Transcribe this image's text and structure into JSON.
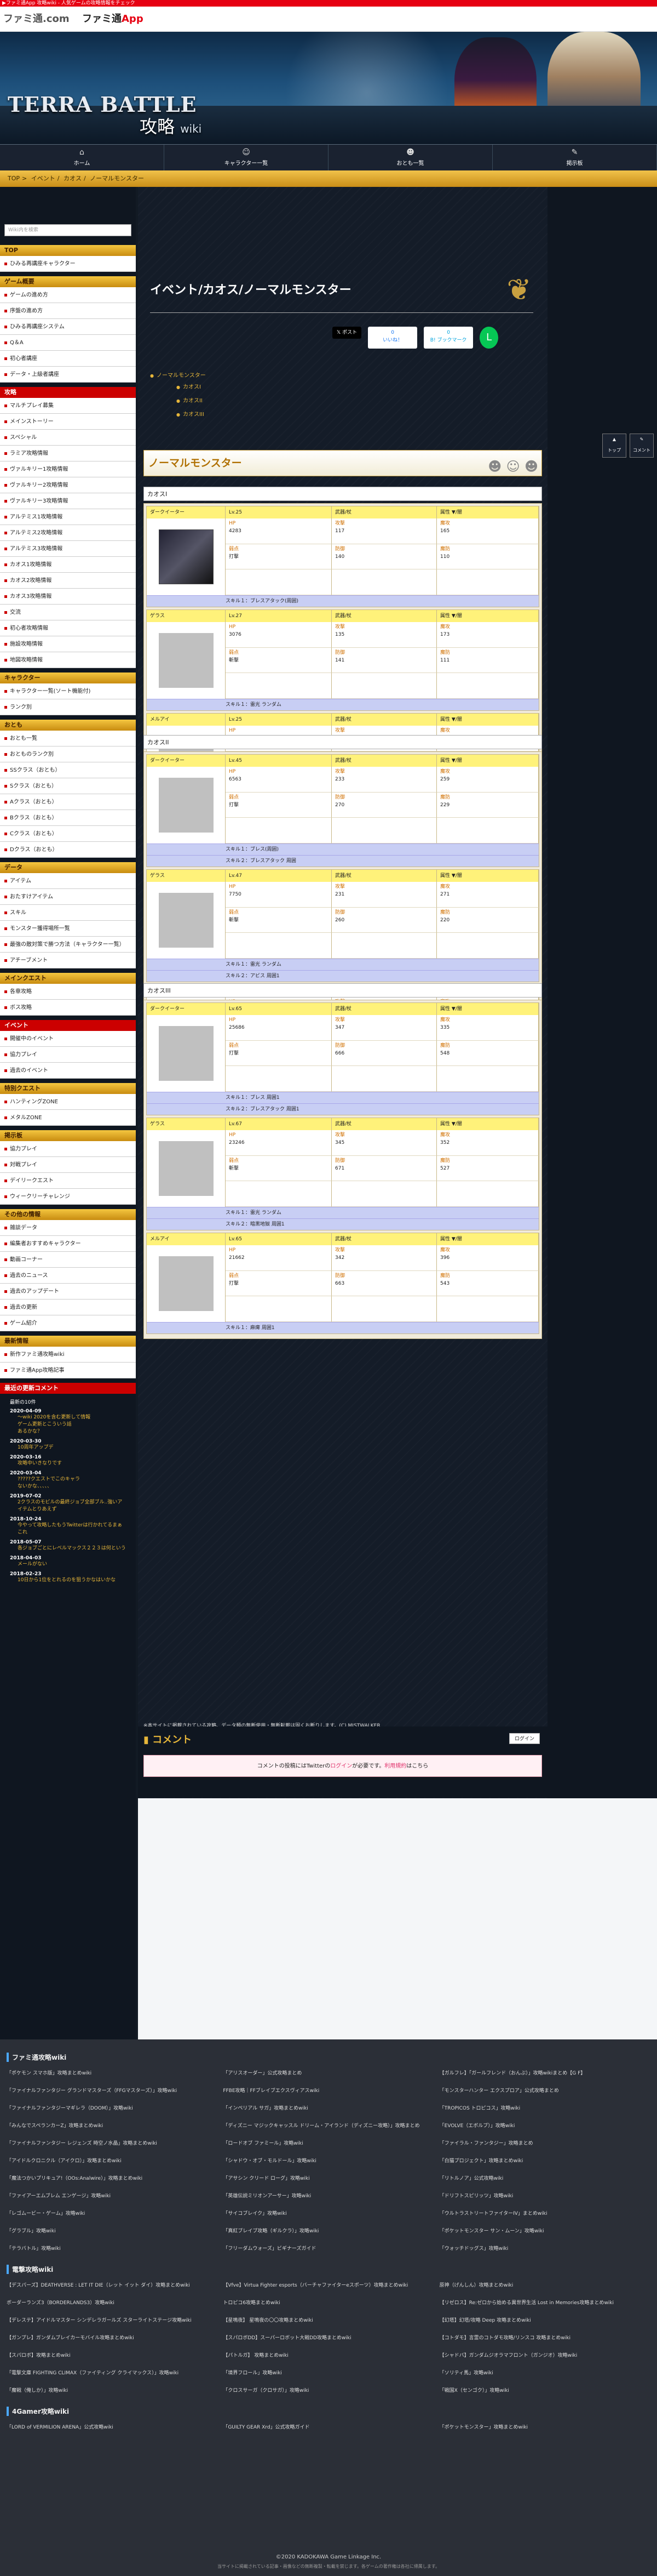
{
  "top_strip": "▶ファミ通App 攻略wiki - 人気ゲームの攻略情報をチェック",
  "site_logo": "ファミ通.com",
  "app_logo": {
    "pre": "ファミ通",
    "post": "App"
  },
  "banner": {
    "logo": "TERRA BATTLE",
    "title": "攻略",
    "title_small": "wiki"
  },
  "nav": [
    {
      "icon": "home-icon",
      "glyph": "⌂",
      "label": "ホーム"
    },
    {
      "icon": "character-icon",
      "glyph": "☺",
      "label": "キャラクター一覧"
    },
    {
      "icon": "monster-icon",
      "glyph": "☻",
      "label": "おとも一覧"
    },
    {
      "icon": "chat-icon",
      "glyph": "✎",
      "label": "掲示板"
    }
  ],
  "breadcrumb": [
    "TOP",
    "イベント",
    "カオス",
    "ノーマルモンスター"
  ],
  "search": {
    "placeholder": "Wiki内を検索"
  },
  "sidebar": [
    {
      "head": "TOP",
      "red": false,
      "items": [
        "ひみる再講座キャラクター"
      ]
    },
    {
      "head": "ゲーム概要",
      "red": false,
      "items": [
        "ゲームの進め方",
        "序盤の進め方",
        "ひみる再講座システム",
        "Q＆A",
        "初心者講座",
        "データ・上級者講座"
      ]
    },
    {
      "head": "攻略",
      "red": true,
      "items": [
        "マルチプレイ募集",
        "メインストーリー",
        "スペシャル",
        "ラミア攻略情報",
        "ヴァルキリー1攻略情報",
        "ヴァルキリー2攻略情報",
        "ヴァルキリー3攻略情報",
        "アルテミス1攻略情報",
        "アルテミス2攻略情報",
        "アルテミス3攻略情報",
        "カオス1攻略情報",
        "カオス2攻略情報",
        "カオス3攻略情報",
        "交流",
        "初心者攻略情報",
        "施設攻略情報",
        "地図攻略情報"
      ]
    },
    {
      "head": "キャラクター",
      "red": false,
      "items": [
        "キャラクター一覧(ソート機能付)",
        "ランク別"
      ]
    },
    {
      "head": "おとも",
      "red": false,
      "items": [
        "おとも一覧",
        "おとものランク別",
        "SSクラス（おとも）",
        "Sクラス（おとも）",
        "Aクラス（おとも）",
        "Bクラス（おとも）",
        "Cクラス（おとも）",
        "Dクラス（おとも）"
      ]
    },
    {
      "head": "データ",
      "red": false,
      "items": [
        "アイテム",
        "おたすけアイテム",
        "スキル",
        "モンスター獲得場所一覧",
        "最強の敵対策で勝つ方法（キャラクター一覧）",
        "アチーブメント"
      ]
    },
    {
      "head": "メインクエスト",
      "red": false,
      "items": [
        "各章攻略",
        "ボス攻略"
      ]
    },
    {
      "head": "イベント",
      "red": true,
      "items": [
        "開催中のイベント",
        "協力プレイ",
        "過去のイベント"
      ]
    },
    {
      "head": "特別クエスト",
      "red": false,
      "items": [
        "ハンティングZONE",
        "メタルZONE"
      ]
    },
    {
      "head": "掲示板",
      "red": false,
      "items": [
        "協力プレイ",
        "対戦プレイ",
        "デイリークエスト",
        "ウィークリーチャレンジ"
      ]
    },
    {
      "head": "その他の情報",
      "red": false,
      "items": [
        "雑談データ",
        "編集者おすすめキャラクター",
        "動画コーナー",
        "過去のニュース",
        "過去のアップデート",
        "過去の更新",
        "ゲーム紹介"
      ]
    },
    {
      "head": "最新情報",
      "red": false,
      "items": [
        "新作ファミ通攻略wiki",
        "ファミ通App攻略記事"
      ]
    }
  ],
  "recent_head": "最近の更新コメント",
  "recent_sub": "最新の10件",
  "recent": [
    {
      "day": "2020-04-09",
      "entries": [
        "〜wiki 2020を含む更新して情報",
        "ゲーム更新とこういう話",
        "あるかな？"
      ]
    },
    {
      "day": "2020-03-30",
      "entries": [
        "10周年アップデ"
      ]
    },
    {
      "day": "2020-03-16",
      "entries": [
        "攻略中いきなりです"
      ]
    },
    {
      "day": "2020-03-04",
      "entries": [
        "?????クエストでこのキャラ",
        "ないかな、、、、、"
      ]
    },
    {
      "day": "2019-07-02",
      "entries": [
        "2クラスのモビルの最終ジョブ全部ブル..強いアイテムとりあえず"
      ]
    },
    {
      "day": "2018-10-24",
      "entries": [
        "今やって攻略したもうTwitterは行かれてるまぁこれ"
      ]
    },
    {
      "day": "2018-05-07",
      "entries": [
        "各ジョブごとにレベルマックス２２３は何という"
      ]
    },
    {
      "day": "2018-04-03",
      "entries": [
        "メールがない"
      ]
    },
    {
      "day": "2018-02-23",
      "entries": [
        "10日から1位をとれるのを狙うかなはいかな"
      ]
    }
  ],
  "page_title": "イベント/カオス/ノーマルモンスター",
  "share": {
    "x": "𝕏 ポスト",
    "fb": "いいね！",
    "fb_count": "0",
    "hb": "B! ブックマーク",
    "hb_count": "0",
    "line": "L"
  },
  "toc": {
    "l1": "ノーマルモンスター",
    "l2": [
      "カオスI",
      "カオスII",
      "カオスIII"
    ]
  },
  "section_title": "ノーマルモンスター",
  "headers": {
    "weapon": "武器/杖",
    "attr": "属性 ▼/闇"
  },
  "labels": {
    "hp": "HP",
    "atk": "攻撃",
    "mag": "魔攻",
    "weak": "弱点",
    "def": "防御",
    "mdef": "魔防"
  },
  "chaos": [
    {
      "title": "カオスI",
      "monsters": [
        {
          "name": "ダークイーター",
          "lv": "Lv.25",
          "img": "dark",
          "hp": "4283",
          "atk": "117",
          "mag": "165",
          "weak": "打撃",
          "def": "140",
          "mdef": "110",
          "skills": [
            "スキル１：ブレスアタック(周囲)"
          ]
        },
        {
          "name": "ゲラス",
          "lv": "Lv.27",
          "img": "",
          "hp": "3076",
          "atk": "135",
          "mag": "173",
          "weak": "斬撃",
          "def": "141",
          "mdef": "111",
          "skills": [
            "スキル１：雷光 ランダム"
          ]
        },
        {
          "name": "メルアイ",
          "lv": "Lv.25",
          "img": "",
          "hp": "3512",
          "atk": "115",
          "mag": "151",
          "weak": "打撃",
          "def": "133",
          "mdef": "113",
          "skills": [
            "スキル１：麻痺 周囲1"
          ]
        }
      ]
    },
    {
      "title": "カオスII",
      "monsters": [
        {
          "name": "ダークイーター",
          "lv": "Lv.45",
          "img": "",
          "hp": "6563",
          "atk": "233",
          "mag": "259",
          "weak": "打撃",
          "def": "270",
          "mdef": "229",
          "skills": [
            "スキル１：ブレス(周囲)",
            "スキル２：ブレスアタック 周囲"
          ]
        },
        {
          "name": "ゲラス",
          "lv": "Lv.47",
          "img": "",
          "hp": "7750",
          "atk": "231",
          "mag": "271",
          "weak": "斬撃",
          "def": "260",
          "mdef": "220",
          "skills": [
            "スキル１：雷光 ランダム",
            "スキル２：アビス 周囲1"
          ]
        },
        {
          "name": "メルアイ",
          "lv": "Lv.45",
          "img": "",
          "hp": "7021",
          "atk": "229",
          "mag": "230",
          "weak": "打撃",
          "def": "277",
          "mdef": "227",
          "skills": [
            "スキル１：麻痺 周囲1"
          ]
        }
      ]
    },
    {
      "title": "カオスIII",
      "monsters": [
        {
          "name": "ダークイーター",
          "lv": "Lv.65",
          "img": "",
          "hp": "25686",
          "atk": "347",
          "mag": "335",
          "weak": "打撃",
          "def": "666",
          "mdef": "548",
          "skills": [
            "スキル１：ブレス 周囲1",
            "スキル２：ブレスアタック 周囲1"
          ]
        },
        {
          "name": "ゲラス",
          "lv": "Lv.67",
          "img": "",
          "hp": "23246",
          "atk": "345",
          "mag": "352",
          "weak": "斬撃",
          "def": "671",
          "mdef": "527",
          "skills": [
            "スキル１：雷光 ランダム",
            "スキル２：暗黒地獄 周囲1"
          ]
        },
        {
          "name": "メルアイ",
          "lv": "Lv.65",
          "img": "",
          "hp": "21662",
          "atk": "342",
          "mag": "396",
          "weak": "打撃",
          "def": "663",
          "mdef": "543",
          "skills": [
            "スキル１：麻痺 周囲1"
          ]
        }
      ]
    }
  ],
  "footnote": "※本サイトに掲載されている攻略、データ類の無断使用・無断転載は固くお断りします。(C) MISTWALKER",
  "right_buttons": [
    "トップ",
    "コメント"
  ],
  "comments": {
    "title": "コメント",
    "login": "ログイン",
    "notice_pre": "コメントの投稿にはTwitterの",
    "notice_link": "ログイン",
    "notice_mid": "が必要です。",
    "notice_rules": "利用規約",
    "notice_post": "はこちら"
  },
  "footer": {
    "sections": [
      {
        "head": "ファミ通攻略wiki",
        "links": [
          "「ポケモン スマホ版」攻略まとめwiki",
          "「アリスオーダー」公式攻略まとめ",
          "【ガルフレ】「ガールフレンド（おんぷ）」攻略wikiまとめ【G F】",
          "「ファイナルファンタジー グランドマスターズ（FFGマスターズ）」攻略wiki",
          "FFBE攻略｜FFブレイブエクスヴィアスwiki",
          "「モンスターハンター エクスプロア」公式攻略まとめ",
          "「ファイナルファンタジーマギレラ（DOOM）」攻略wiki",
          "「インペリアル サガ」攻略まとめwiki",
          "「TROPICOS トロピコス」攻略wiki",
          "「みんなでスペランカーZ」攻略まとめwiki",
          "「ディズニー マジックキャッスル ドリーム・アイランド（ディズニー攻略）」攻略まとめ",
          "「EVOLVE（エボルブ）」攻略wiki",
          "「ファイナルファンタジー レジェンズ 時空ノ水晶」攻略まとめwiki",
          "「ロードオブ ファミール」攻略wiki",
          "「ファイラル・ファンタジー」攻略まとめ",
          "「アイドルクロニクル（アイクロ）」攻略まとめwiki",
          "「シャドウ・オブ・モルドール」攻略wiki",
          "「白猫プロジェクト」攻略まとめwiki",
          "「魔法つかいプリキュア!（OOs:Analwire）」攻略まとめwiki",
          "「アサシン クリード ローグ」攻略wiki",
          "「リトルノア」公式攻略wiki",
          "「ファイアーエムブレム エンゲージ」攻略wiki",
          "「英雄伝説ミリオンアーサー」攻略wiki",
          "「ドリフトスピリッツ」攻略wiki",
          "「レゴムービー・ゲーム」攻略wiki",
          "「サイコブレイク」攻略wiki",
          "「ウルトラストリートファイターIV」まとめwiki",
          "「グラブル」攻略wiki",
          "「真紅ブレイブ攻略（ギルクラ）」攻略wiki",
          "「ポケットモンスター サン・ムーン」攻略wiki",
          "「テラバトル」攻略wiki",
          "「フリーダムウォーズ」ビギナーズガイド",
          "「ウォッチドッグス」攻略wiki"
        ]
      },
      {
        "head": "電撃攻略wiki",
        "links": [
          "【デスパーズ】DEATHVERSE : LET IT DIE（レット イット ダイ）攻略まとめwiki",
          "【Vfve】Virtua Fighter esports（バーチャファイターeスポーツ）攻略まとめwiki",
          "原神（げんしん）攻略まとめwiki",
          "ボーダーランズ3（BORDERLANDS3）攻略wiki",
          "トロピコ6攻略まとめwiki",
          "【リゼロス】Re:ゼロから始める異世界生活 Lost in Memories攻略まとめwiki",
          "【デレステ】アイドルマスター シンデレラガールズ スターライトステージ攻略wiki",
          "【星鳴夜】 星鳴夜の〇〇攻略まとめwiki",
          "【幻塔】幻塔/攻略 Deep 攻略まとめwiki",
          "【ガンプレ】ガンダムブレイカーモバイル攻略まとめwiki",
          "【スパロボDD】スーパーロボット大戦DD攻略まとめwiki",
          "【コトダモ】言霊のコトダモ攻略/リンスコ 攻略まとめwiki",
          "【スパロボ】攻略まとめwiki",
          "【パトルガ】 攻略まとめwiki",
          "【シャドバ】ガンダムジオラマフロント（ガンジオ）攻略wiki",
          "「電撃文庫 FIGHTING CLIMAX（ファイティング クライマックス）」攻略wiki",
          "「境界フロール」攻略wiki",
          "「ソリティ馬」攻略wiki",
          "「魔戦（俺しか）」攻略wiki",
          "「クロスサーガ（クロサガ）」攻略wiki",
          "「戦国X（センゴク）」攻略wiki"
        ]
      },
      {
        "head": "4Gamer攻略wiki",
        "links": [
          "「LORD of VERMILION ARENA」公式攻略wiki",
          "「GUILTY GEAR Xrd」公式攻略ガイド",
          "「ポケットモンスター」攻略まとめwiki"
        ]
      }
    ],
    "copyright": "©2020 KADOKAWA Game Linkage Inc.",
    "small": "当サイトに掲載されている記事・画像などの無断複製・転載を禁じます。各ゲームの著作権は各社に帰属します。"
  }
}
